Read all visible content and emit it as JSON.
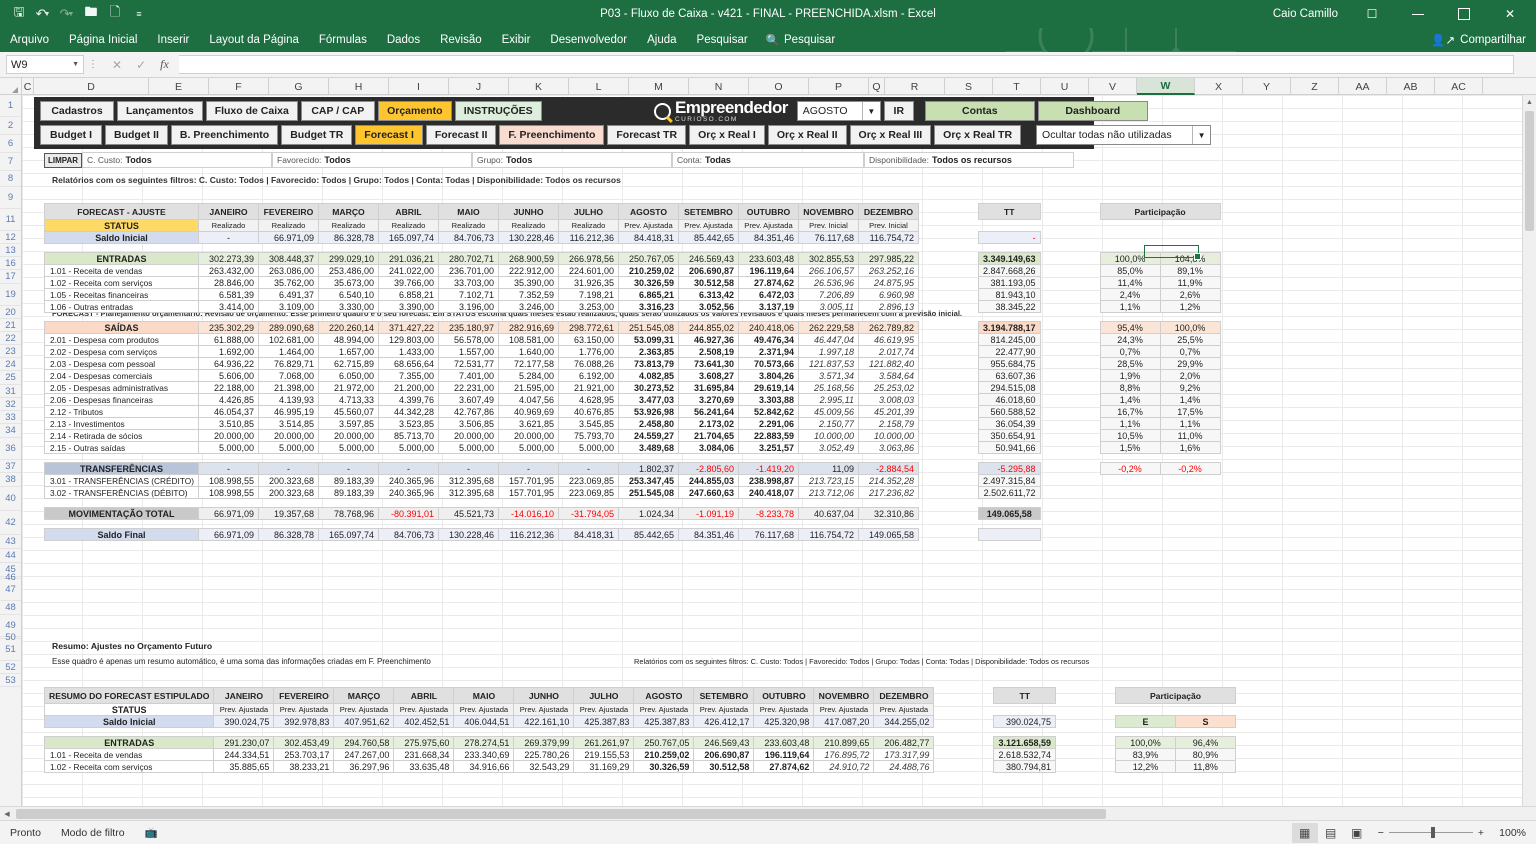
{
  "window": {
    "doc_title": "P03 - Fluxo de Caixa - v421 - FINAL - PREENCHIDA.xlsm  -  Excel",
    "user": "Caio Camillo",
    "share_label": "Compartilhar"
  },
  "quick_access": [
    "save-icon",
    "undo-icon",
    "redo-icon",
    "open-icon",
    "new-icon",
    "customize-icon"
  ],
  "ribbon": {
    "tabs": [
      "Arquivo",
      "Página Inicial",
      "Inserir",
      "Layout da Página",
      "Fórmulas",
      "Dados",
      "Revisão",
      "Exibir",
      "Desenvolvedor",
      "Ajuda",
      "Pesquisar"
    ],
    "search_placeholder": "Pesquisar"
  },
  "formula_bar": {
    "name_box": "W9",
    "formula": ""
  },
  "columns": [
    "C",
    "D",
    "E",
    "F",
    "G",
    "H",
    "I",
    "J",
    "K",
    "L",
    "M",
    "N",
    "O",
    "P",
    "Q",
    "R",
    "S",
    "T",
    "U",
    "V",
    "W",
    "X",
    "Y",
    "Z",
    "AA",
    "AB",
    "AC"
  ],
  "selected_column": "W",
  "row_headers": [
    "1",
    "2",
    "6",
    "7",
    "8",
    "9",
    "11",
    "12",
    "13",
    "16",
    "17",
    "19",
    "20",
    "21",
    "22",
    "23",
    "24",
    "25",
    "31",
    "32",
    "33",
    "34",
    "36",
    "37",
    "38",
    "40",
    "42",
    "43",
    "44",
    "45",
    "46",
    "47",
    "48",
    "49",
    "50",
    "51",
    "52",
    "53"
  ],
  "nav": {
    "row1": [
      "Cadastros",
      "Lançamentos",
      "Fluxo de Caixa",
      "CAP / CAP",
      "Orçamento",
      "INSTRUÇÕES"
    ],
    "row1_active": "Orçamento",
    "row1_mint": "INSTRUÇÕES",
    "row2": [
      "Budget I",
      "Budget II",
      "B. Preenchimento",
      "Budget TR",
      "Forecast I",
      "Forecast II",
      "F. Preenchimento",
      "Forecast TR",
      "Orç x Real I",
      "Orç x Real II",
      "Orç x Real III",
      "Orç x Real TR"
    ],
    "row2_active": "Forecast I",
    "row2_peach": "F. Preenchimento",
    "logo_title": "Empreendedor",
    "logo_sub": "CURIOSO.COM",
    "month_select": "AGOSTO",
    "ir_button": "IR",
    "contas_button": "Contas",
    "dashboard_button": "Dashboard",
    "hide_select": "Ocultar todas não utilizadas"
  },
  "filters": {
    "limpar": "LIMPAR",
    "items": [
      {
        "label": "C. Custo:",
        "value": "Todos"
      },
      {
        "label": "Favorecido:",
        "value": "Todos"
      },
      {
        "label": "Grupo:",
        "value": "Todos"
      },
      {
        "label": "Conta:",
        "value": "Todas"
      },
      {
        "label": "Disponibilidade:",
        "value": "Todos os recursos"
      }
    ],
    "summary": "Relatórios com os seguintes filtros: C. Custo: Todos | Favorecido: Todos | Grupo: Todos | Conta: Todas | Disponibilidade: Todos os recursos"
  },
  "notes": {
    "forecast_note": "FORECAST - Planejamento orçamentário: Revisão de orçamento: Esse primeiro quadro é o seu forecast. Em STATUS escolha quais meses estão realizados, quais serão utilizados os valores revisados e quais meses permanecem com a previsão inicial.",
    "resumo_title": "Resumo: Ajustes no Orçamento Futuro",
    "resumo_note": "Esse quadro é apenas um resumo automático, é uma soma das informações criadas em F. Preenchimento",
    "resumo_filters": "Relatórios com os seguintes filtros: C. Custo: Todos | Favorecido: Todos | Grupo: Todas | Conta: Todas | Disponibilidade: Todos os recursos"
  },
  "chart_data": {
    "type": "table",
    "title": "FORECAST - AJUSTE",
    "months": [
      "JANEIRO",
      "FEVEREIRO",
      "MARÇO",
      "ABRIL",
      "MAIO",
      "JUNHO",
      "JULHO",
      "AGOSTO",
      "SETEMBRO",
      "OUTUBRO",
      "NOVEMBRO",
      "DEZEMBRO"
    ],
    "total_label": "TT",
    "participation_label": "Participação",
    "participation_cols": [
      "E",
      "S"
    ],
    "table1": {
      "header_label": "FORECAST - AJUSTE",
      "status_label": "STATUS",
      "status_values": [
        "Realizado",
        "Realizado",
        "Realizado",
        "Realizado",
        "Realizado",
        "Realizado",
        "Realizado",
        "Prev. Ajustada",
        "Prev. Ajustada",
        "Prev. Ajustada",
        "Prev. Inicial",
        "Prev. Inicial"
      ],
      "rows": [
        {
          "kind": "lav",
          "label": "Saldo Inicial",
          "values": [
            "-",
            "66.971,09",
            "86.328,78",
            "165.097,74",
            "84.706,73",
            "130.228,46",
            "116.212,36",
            "84.418,31",
            "85.442,65",
            "84.351,46",
            "76.117,68",
            "116.754,72"
          ],
          "tt": "-",
          "e": "",
          "s": ""
        },
        {
          "kind": "green",
          "label": "ENTRADAS",
          "values": [
            "302.273,39",
            "308.448,37",
            "299.029,10",
            "291.036,21",
            "280.702,71",
            "268.900,59",
            "266.978,56",
            "250.767,05",
            "246.569,43",
            "233.603,48",
            "302.855,53",
            "297.985,22"
          ],
          "tt": "3.349.149,63",
          "e": "100,0%",
          "s": "104,8%"
        },
        {
          "kind": "item",
          "label": "1.01 - Receita de vendas",
          "values": [
            "263.432,00",
            "263.086,00",
            "253.486,00",
            "241.022,00",
            "236.701,00",
            "222.912,00",
            "224.601,00",
            "210.259,02",
            "206.690,87",
            "196.119,64",
            "266.106,57",
            "263.252,16"
          ],
          "tt": "2.847.668,26",
          "e": "85,0%",
          "s": "89,1%"
        },
        {
          "kind": "item",
          "label": "1.02 - Receita com serviços",
          "values": [
            "28.846,00",
            "35.762,00",
            "35.673,00",
            "39.766,00",
            "33.703,00",
            "35.390,00",
            "31.926,35",
            "30.326,59",
            "30.512,58",
            "27.874,62",
            "26.536,96",
            "24.875,95"
          ],
          "tt": "381.193,05",
          "e": "11,4%",
          "s": "11,9%"
        },
        {
          "kind": "item",
          "label": "1.05 - Receitas financeiras",
          "values": [
            "6.581,39",
            "6.491,37",
            "6.540,10",
            "6.858,21",
            "7.102,71",
            "7.352,59",
            "7.198,21",
            "6.865,21",
            "6.313,42",
            "6.472,03",
            "7.206,89",
            "6.960,98"
          ],
          "tt": "81.943,10",
          "e": "2,4%",
          "s": "2,6%"
        },
        {
          "kind": "item",
          "label": "1.06 - Outras entradas",
          "values": [
            "3.414,00",
            "3.109,00",
            "3.330,00",
            "3.390,00",
            "3.196,00",
            "3.246,00",
            "3.253,00",
            "3.316,23",
            "3.052,56",
            "3.137,19",
            "3.005,11",
            "2.896,13"
          ],
          "tt": "38.345,22",
          "e": "1,1%",
          "s": "1,2%"
        },
        {
          "kind": "peach",
          "label": "SAÍDAS",
          "values": [
            "235.302,29",
            "289.090,68",
            "220.260,14",
            "371.427,22",
            "235.180,97",
            "282.916,69",
            "298.772,61",
            "251.545,08",
            "244.855,02",
            "240.418,06",
            "262.229,58",
            "262.789,82"
          ],
          "tt": "3.194.788,17",
          "e": "95,4%",
          "s": "100,0%"
        },
        {
          "kind": "item",
          "label": "2.01 - Despesa com produtos",
          "values": [
            "61.888,00",
            "102.681,00",
            "48.994,00",
            "129.803,00",
            "56.578,00",
            "108.581,00",
            "63.150,00",
            "53.099,31",
            "46.927,36",
            "49.476,34",
            "46.447,04",
            "46.619,95"
          ],
          "tt": "814.245,00",
          "e": "24,3%",
          "s": "25,5%"
        },
        {
          "kind": "item",
          "label": "2.02 - Despesa com serviços",
          "values": [
            "1.692,00",
            "1.464,00",
            "1.657,00",
            "1.433,00",
            "1.557,00",
            "1.640,00",
            "1.776,00",
            "2.363,85",
            "2.508,19",
            "2.371,94",
            "1.997,18",
            "2.017,74"
          ],
          "tt": "22.477,90",
          "e": "0,7%",
          "s": "0,7%"
        },
        {
          "kind": "item",
          "label": "2.03 - Despesa com pessoal",
          "values": [
            "64.936,22",
            "76.829,71",
            "62.715,89",
            "68.656,64",
            "72.531,77",
            "72.177,58",
            "76.088,26",
            "73.813,79",
            "73.641,30",
            "70.573,66",
            "121.837,53",
            "121.882,40"
          ],
          "tt": "955.684,75",
          "e": "28,5%",
          "s": "29,9%"
        },
        {
          "kind": "item",
          "label": "2.04 - Despesas comerciais",
          "values": [
            "5.606,00",
            "7.068,00",
            "6.050,00",
            "7.355,00",
            "7.401,00",
            "5.284,00",
            "6.192,00",
            "4.082,85",
            "3.608,27",
            "3.804,26",
            "3.571,34",
            "3.584,64"
          ],
          "tt": "63.607,36",
          "e": "1,9%",
          "s": "2,0%"
        },
        {
          "kind": "item",
          "label": "2.05 - Despesas administrativas",
          "values": [
            "22.188,00",
            "21.398,00",
            "21.972,00",
            "21.200,00",
            "22.231,00",
            "21.595,00",
            "21.921,00",
            "30.273,52",
            "31.695,84",
            "29.619,14",
            "25.168,56",
            "25.253,02"
          ],
          "tt": "294.515,08",
          "e": "8,8%",
          "s": "9,2%"
        },
        {
          "kind": "item",
          "label": "2.06 - Despesas financeiras",
          "values": [
            "4.426,85",
            "4.139,93",
            "4.713,33",
            "4.399,76",
            "3.607,49",
            "4.047,56",
            "4.628,95",
            "3.477,03",
            "3.270,69",
            "3.303,88",
            "2.995,11",
            "3.008,03"
          ],
          "tt": "46.018,60",
          "e": "1,4%",
          "s": "1,4%"
        },
        {
          "kind": "item",
          "label": "2.12 - Tributos",
          "values": [
            "46.054,37",
            "46.995,19",
            "45.560,07",
            "44.342,28",
            "42.767,86",
            "40.969,69",
            "40.676,85",
            "53.926,98",
            "56.241,64",
            "52.842,62",
            "45.009,56",
            "45.201,39"
          ],
          "tt": "560.588,52",
          "e": "16,7%",
          "s": "17,5%"
        },
        {
          "kind": "item",
          "label": "2.13 - Investimentos",
          "values": [
            "3.510,85",
            "3.514,85",
            "3.597,85",
            "3.523,85",
            "3.506,85",
            "3.621,85",
            "3.545,85",
            "2.458,80",
            "2.173,02",
            "2.291,06",
            "2.150,77",
            "2.158,79"
          ],
          "tt": "36.054,39",
          "e": "1,1%",
          "s": "1,1%"
        },
        {
          "kind": "item",
          "label": "2.14 - Retirada de sócios",
          "values": [
            "20.000,00",
            "20.000,00",
            "20.000,00",
            "85.713,70",
            "20.000,00",
            "20.000,00",
            "75.793,70",
            "24.559,27",
            "21.704,65",
            "22.883,59",
            "10.000,00",
            "10.000,00"
          ],
          "tt": "350.654,91",
          "e": "10,5%",
          "s": "11,0%"
        },
        {
          "kind": "item",
          "label": "2.15 - Outras saídas",
          "values": [
            "5.000,00",
            "5.000,00",
            "5.000,00",
            "5.000,00",
            "5.000,00",
            "5.000,00",
            "5.000,00",
            "3.489,68",
            "3.084,06",
            "3.251,57",
            "3.052,49",
            "3.063,86"
          ],
          "tt": "50.941,66",
          "e": "1,5%",
          "s": "1,6%"
        },
        {
          "kind": "slate",
          "label": "TRANSFERÊNCIAS",
          "values": [
            "-",
            "-",
            "-",
            "-",
            "-",
            "-",
            "-",
            "1.802,37",
            "-2.805,60",
            "-1.419,20",
            "11,09",
            "-2.884,54"
          ],
          "tt": "-5.295,88",
          "e": "-0,2%",
          "s": "-0,2%"
        },
        {
          "kind": "item",
          "label": "3.01 - TRANSFERÊNCIAS (CRÉDITO)",
          "values": [
            "108.998,55",
            "200.323,68",
            "89.183,39",
            "240.365,96",
            "312.395,68",
            "157.701,95",
            "223.069,85",
            "253.347,45",
            "244.855,03",
            "238.998,87",
            "213.723,15",
            "214.352,28"
          ],
          "tt": "2.497.315,84",
          "e": "",
          "s": ""
        },
        {
          "kind": "item",
          "label": "3.02 - TRANSFERÊNCIAS (DÉBITO)",
          "values": [
            "108.998,55",
            "200.323,68",
            "89.183,39",
            "240.365,96",
            "312.395,68",
            "157.701,95",
            "223.069,85",
            "251.545,08",
            "247.660,63",
            "240.418,07",
            "213.712,06",
            "217.236,82"
          ],
          "tt": "2.502.611,72",
          "e": "",
          "s": ""
        },
        {
          "kind": "grey",
          "label": "MOVIMENTAÇÃO TOTAL",
          "values": [
            "66.971,09",
            "19.357,68",
            "78.768,96",
            "-80.391,01",
            "45.521,73",
            "-14.016,10",
            "-31.794,05",
            "1.024,34",
            "-1.091,19",
            "-8.233,78",
            "40.637,04",
            "32.310,86"
          ],
          "tt": "149.065,58",
          "e": "",
          "s": ""
        },
        {
          "kind": "lav",
          "label": "Saldo Final",
          "values": [
            "66.971,09",
            "86.328,78",
            "165.097,74",
            "84.706,73",
            "130.228,46",
            "116.212,36",
            "84.418,31",
            "85.442,65",
            "84.351,46",
            "76.117,68",
            "116.754,72",
            "149.065,58"
          ],
          "tt": "",
          "e": "",
          "s": ""
        }
      ]
    },
    "table2": {
      "header_label": "RESUMO DO FORECAST ESTIPULADO",
      "status_label": "STATUS",
      "status_values": [
        "Prev. Ajustada",
        "Prev. Ajustada",
        "Prev. Ajustada",
        "Prev. Ajustada",
        "Prev. Ajustada",
        "Prev. Ajustada",
        "Prev. Ajustada",
        "Prev. Ajustada",
        "Prev. Ajustada",
        "Prev. Ajustada",
        "Prev. Ajustada",
        "Prev. Ajustada"
      ],
      "rows": [
        {
          "kind": "lav",
          "label": "Saldo Inicial",
          "values": [
            "390.024,75",
            "392.978,83",
            "407.951,62",
            "402.452,51",
            "406.044,51",
            "422.161,10",
            "425.387,83",
            "425.387,83",
            "426.412,17",
            "425.320,98",
            "417.087,20",
            "344.255,02"
          ],
          "tt": "390.024,75",
          "e": "E",
          "s": "S"
        },
        {
          "kind": "green",
          "label": "ENTRADAS",
          "values": [
            "291.230,07",
            "302.453,49",
            "294.760,58",
            "275.975,60",
            "278.274,51",
            "269.379,99",
            "261.261,97",
            "250.767,05",
            "246.569,43",
            "233.603,48",
            "210.899,65",
            "206.482,77"
          ],
          "tt": "3.121.658,59",
          "e": "100,0%",
          "s": "96,4%"
        },
        {
          "kind": "item",
          "label": "1.01 - Receita de vendas",
          "values": [
            "244.334,51",
            "253.703,17",
            "247.267,00",
            "231.668,34",
            "233.340,69",
            "225.780,26",
            "219.155,53",
            "210.259,02",
            "206.690,87",
            "196.119,64",
            "176.895,72",
            "173.317,99"
          ],
          "tt": "2.618.532,74",
          "e": "83,9%",
          "s": "80,9%"
        },
        {
          "kind": "item",
          "label": "1.02 - Receita com serviços",
          "values": [
            "35.885,65",
            "38.233,21",
            "36.297,96",
            "33.635,48",
            "34.916,66",
            "32.543,29",
            "31.169,29",
            "30.326,59",
            "30.512,58",
            "27.874,62",
            "24.910,72",
            "24.488,76"
          ],
          "tt": "380.794,81",
          "e": "12,2%",
          "s": "11,8%"
        }
      ]
    }
  },
  "status_bar": {
    "mode": "Pronto",
    "filter_mode": "Modo de filtro",
    "macro_icon": "record-macro-icon",
    "views": [
      "normal-view-icon",
      "page-layout-icon",
      "page-break-icon"
    ],
    "active_view": "normal-view-icon",
    "zoom": "100%"
  }
}
